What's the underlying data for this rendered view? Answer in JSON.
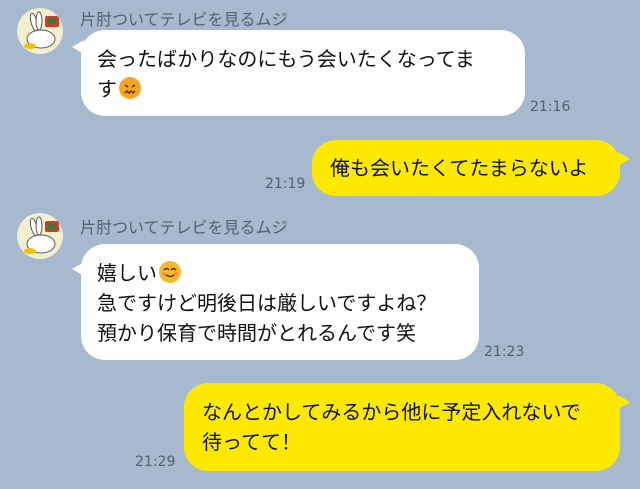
{
  "sender_name": "片肘ついてテレビを見るムジ",
  "icons": {
    "avatar": "mouji-rabbit-tv-icon",
    "emoji_angry": "persevering-face-emoji",
    "emoji_smile": "smiling-face-emoji"
  },
  "colors": {
    "background": "#a6b9cf",
    "incoming_bubble": "#ffffff",
    "outgoing_bubble": "#fde900"
  },
  "messages": [
    {
      "direction": "incoming",
      "text": "会ったばかりなのにもう会いたくなってま\nす",
      "emoji": "angry",
      "time": "21:16"
    },
    {
      "direction": "outgoing",
      "text": "俺も会いたくてたまらないよ",
      "time": "21:19"
    },
    {
      "direction": "incoming",
      "text_line1": "嬉しい",
      "emoji": "smile",
      "text_rest": "急ですけど明後日は厳しいですよね？\n預かり保育で時間がとれるんです笑",
      "time": "21:23"
    },
    {
      "direction": "outgoing",
      "text": "なんとかしてみるから他に予定入れないで\n待ってて！",
      "time": "21:29"
    }
  ]
}
